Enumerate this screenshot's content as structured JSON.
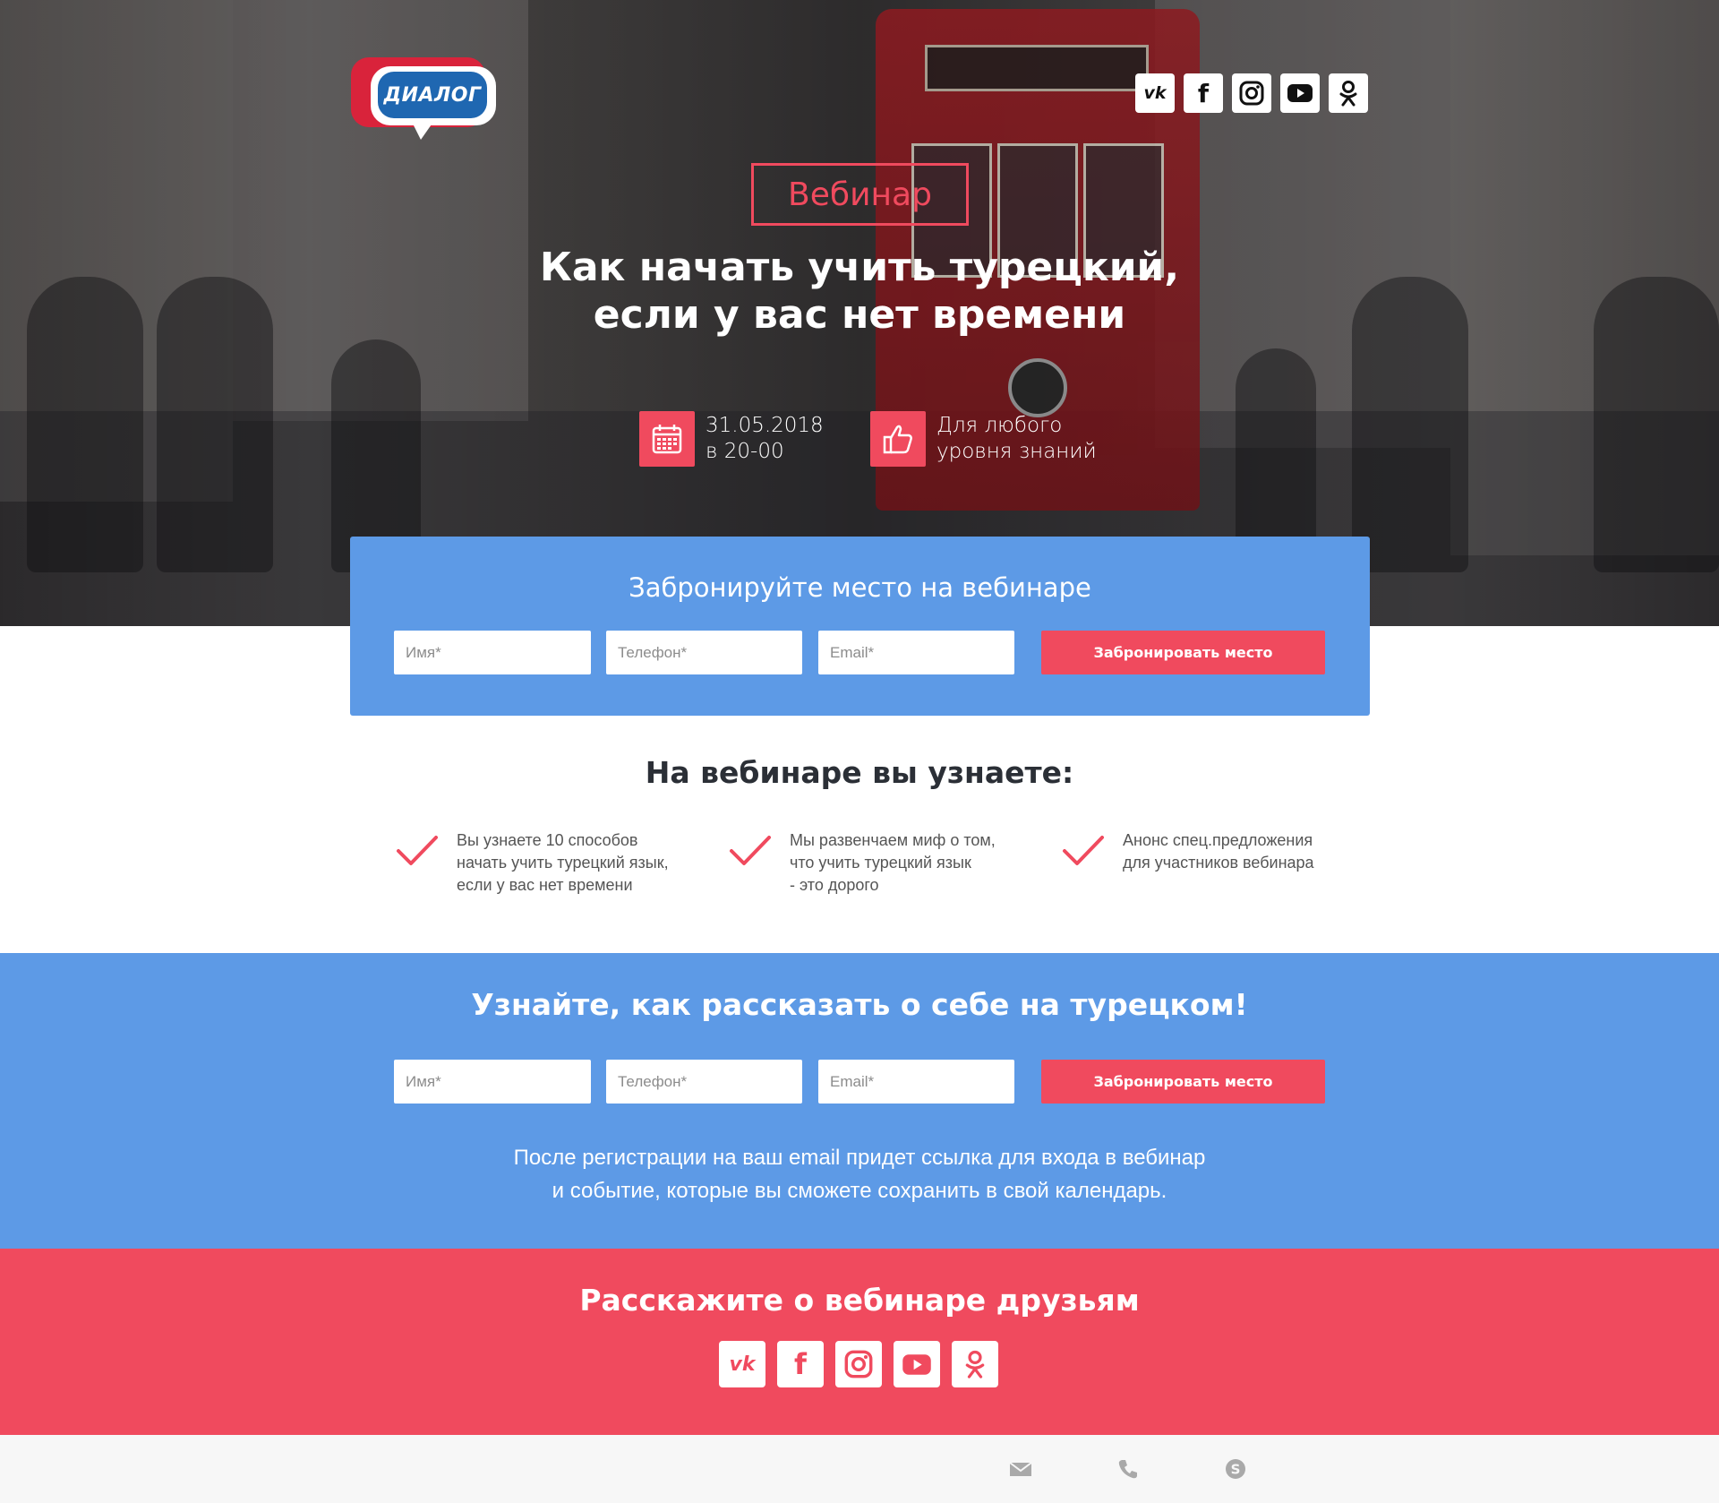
{
  "brand": {
    "logo_text": "ДИАЛОГ"
  },
  "social": [
    {
      "name": "vk-icon",
      "glyph": "vk"
    },
    {
      "name": "facebook-icon",
      "glyph": "f"
    },
    {
      "name": "instagram-icon",
      "glyph": ""
    },
    {
      "name": "youtube-icon",
      "glyph": ""
    },
    {
      "name": "odnoklassniki-icon",
      "glyph": ""
    }
  ],
  "hero": {
    "badge": "Вебинар",
    "headline_line1": "Как начать учить турецкий,",
    "headline_line2": "если у вас нет времени",
    "date_line1": "31.05.2018",
    "date_line2": "в 20-00",
    "level_line1": "Для любого",
    "level_line2": "уровня знаний"
  },
  "booking_form": {
    "title": "Забронируйте место на вебинаре",
    "name_placeholder": "Имя*",
    "phone_placeholder": "Телефон*",
    "email_placeholder": "Email*",
    "submit_label": "Забронировать место"
  },
  "features": {
    "title": "На вебинаре вы узнаете:",
    "items": [
      {
        "line1": "Вы узнаете 10 способов",
        "line2": "начать учить турецкий язык,",
        "line3": "если у вас нет времени"
      },
      {
        "line1": "Мы развенчаем миф о том,",
        "line2": "что учить турецкий язык",
        "line3": "- это дорого"
      },
      {
        "line1": "Анонс спец.предложения",
        "line2": "для участников вебинара",
        "line3": ""
      }
    ]
  },
  "signup_section": {
    "title": "Узнайте, как рассказать о себе на турецком!",
    "name_placeholder": "Имя*",
    "phone_placeholder": "Телефон*",
    "email_placeholder": "Email*",
    "submit_label": "Забронировать место",
    "note_line1": "После регистрации на ваш email придет ссылка для входа в вебинар",
    "note_line2": "и событие, которые вы сможете сохранить в свой календарь."
  },
  "share_section": {
    "title": "Расскажите о вебинаре друзьям"
  },
  "footer": {
    "icons": [
      "mail-icon",
      "phone-icon",
      "skype-icon"
    ]
  },
  "colors": {
    "accent_red": "#f04a5e",
    "accent_blue": "#5d9ae6",
    "logo_blue": "#1f67b1",
    "logo_red": "#d9233b"
  }
}
